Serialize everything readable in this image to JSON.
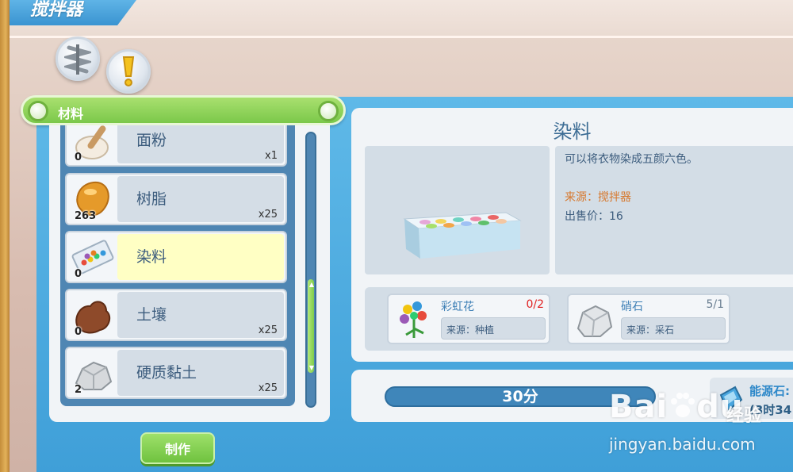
{
  "window": {
    "title": "搅拌器"
  },
  "category": {
    "label": "材料"
  },
  "materials": [
    {
      "name": "面粉",
      "count": "0",
      "mult": "x1",
      "icon": "flour-icon"
    },
    {
      "name": "树脂",
      "count": "263",
      "mult": "x25",
      "icon": "resin-icon"
    },
    {
      "name": "染料",
      "count": "0",
      "mult": "",
      "icon": "dye-palette-icon"
    },
    {
      "name": "土壤",
      "count": "0",
      "mult": "x25",
      "icon": "soil-icon"
    },
    {
      "name": "硬质黏土",
      "count": "2",
      "mult": "x25",
      "icon": "clay-icon"
    }
  ],
  "make_button": "制作",
  "detail": {
    "title": "染料",
    "description": "可以将衣物染成五颜六色。",
    "source": "来源：搅拌器",
    "price": "出售价：16"
  },
  "requirements": [
    {
      "name": "彩虹花",
      "qty": "0/2",
      "qty_color": "#e02020",
      "source": "来源：种植",
      "icon": "rainbow-flower-icon"
    },
    {
      "name": "硝石",
      "qty": "5/1",
      "qty_color": "#6b7f92",
      "source": "来源：采石",
      "icon": "saltpeter-icon"
    }
  ],
  "timer": {
    "label": "30分"
  },
  "energy": {
    "label": "能源石:",
    "time": "(3时34"
  },
  "watermark": {
    "brand": "Bai",
    "brand_end": "du",
    "sub": "经验",
    "url": "jingyan.baidu.com"
  },
  "colors": {
    "accent_green": "#7bc84a",
    "panel_blue": "#3f9fd8",
    "selected_row": "#ffffc4"
  }
}
